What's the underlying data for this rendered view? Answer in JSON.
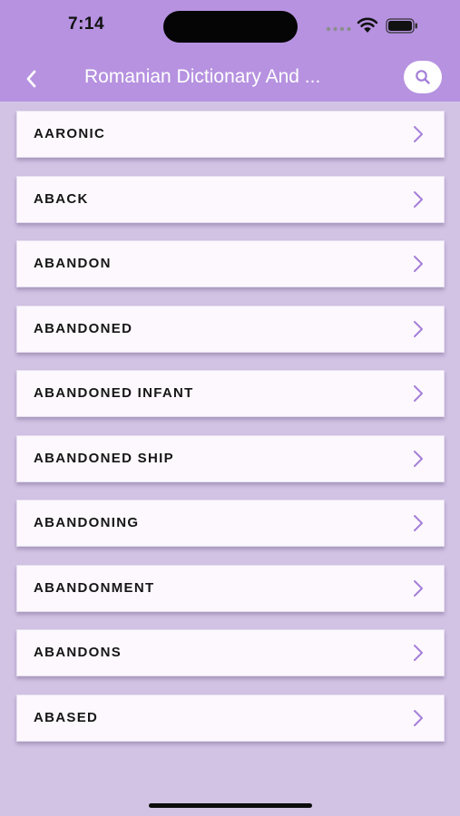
{
  "status_bar": {
    "time": "7:14"
  },
  "nav": {
    "title": "Romanian Dictionary And ...",
    "back_icon": "chevron-left-icon",
    "search_icon": "search-icon"
  },
  "colors": {
    "header": "#b692e0",
    "background": "#d2c3e5",
    "card": "#fcf8fd",
    "chevron": "#a57fd8"
  },
  "words": [
    {
      "label": "AARONIC"
    },
    {
      "label": "ABACK"
    },
    {
      "label": "ABANDON"
    },
    {
      "label": "ABANDONED"
    },
    {
      "label": "ABANDONED INFANT"
    },
    {
      "label": "ABANDONED SHIP"
    },
    {
      "label": "ABANDONING"
    },
    {
      "label": "ABANDONMENT"
    },
    {
      "label": "ABANDONS"
    },
    {
      "label": "ABASED"
    }
  ]
}
